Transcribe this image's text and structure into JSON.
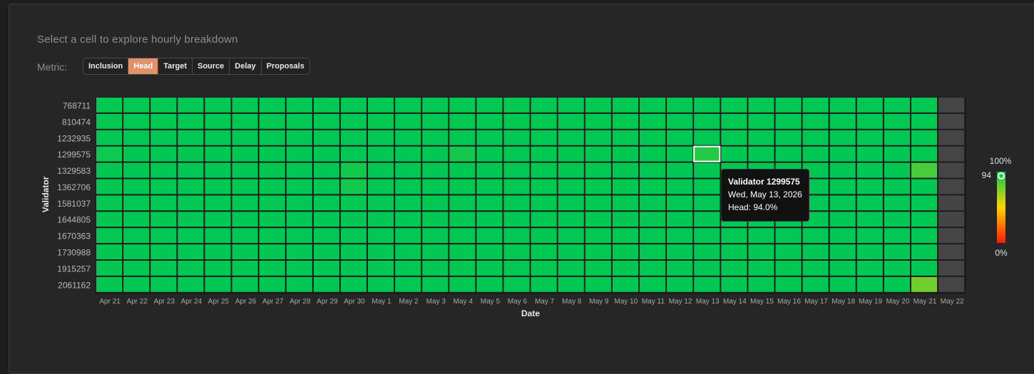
{
  "subtitle": "Select a cell to explore hourly breakdown",
  "metric": {
    "label": "Metric:",
    "options": [
      "Inclusion",
      "Head",
      "Target",
      "Source",
      "Delay",
      "Proposals"
    ],
    "selected": "Head"
  },
  "chart_data": {
    "type": "heatmap",
    "xlabel": "Date",
    "ylabel": "Validator",
    "x": [
      "Apr 21",
      "Apr 22",
      "Apr 23",
      "Apr 24",
      "Apr 25",
      "Apr 26",
      "Apr 27",
      "Apr 28",
      "Apr 29",
      "Apr 30",
      "May 1",
      "May 2",
      "May 3",
      "May 4",
      "May 5",
      "May 6",
      "May 7",
      "May 8",
      "May 9",
      "May 10",
      "May 11",
      "May 12",
      "May 13",
      "May 14",
      "May 15",
      "May 16",
      "May 17",
      "May 18",
      "May 19",
      "May 20",
      "May 21",
      "May 22"
    ],
    "y": [
      "768711",
      "810474",
      "1232935",
      "1299575",
      "1329583",
      "1362706",
      "1581037",
      "1644805",
      "1670363",
      "1730988",
      "1915257",
      "2061162"
    ],
    "values": [
      [
        100,
        100,
        100,
        100,
        100,
        100,
        100,
        100,
        100,
        100,
        100,
        100,
        100,
        100,
        100,
        99,
        100,
        100,
        100,
        100,
        100,
        100,
        100,
        100,
        100,
        100,
        100,
        100,
        100,
        100,
        100,
        null
      ],
      [
        100,
        100,
        100,
        100,
        100,
        100,
        100,
        100,
        100,
        100,
        99,
        100,
        100,
        100,
        100,
        100,
        100,
        100,
        100,
        100,
        100,
        100,
        100,
        100,
        100,
        100,
        100,
        100,
        100,
        100,
        100,
        null
      ],
      [
        100,
        100,
        100,
        100,
        100,
        100,
        100,
        100,
        100,
        100,
        100,
        100,
        100,
        100,
        100,
        100,
        100,
        100,
        100,
        100,
        100,
        100,
        100,
        100,
        100,
        100,
        100,
        100,
        100,
        100,
        100,
        null
      ],
      [
        97,
        100,
        100,
        99,
        100,
        100,
        100,
        100,
        100,
        100,
        100,
        100,
        100,
        96,
        100,
        100,
        100,
        99,
        100,
        100,
        100,
        100,
        94,
        100,
        100,
        100,
        100,
        100,
        100,
        100,
        100,
        null
      ],
      [
        100,
        100,
        100,
        100,
        100,
        100,
        99,
        100,
        100,
        96,
        100,
        100,
        100,
        100,
        100,
        100,
        100,
        100,
        100,
        100,
        100,
        100,
        100,
        100,
        100,
        100,
        100,
        100,
        100,
        100,
        91,
        null
      ],
      [
        100,
        100,
        100,
        100,
        100,
        100,
        100,
        100,
        100,
        96,
        100,
        100,
        100,
        100,
        100,
        100,
        100,
        100,
        100,
        100,
        100,
        100,
        100,
        100,
        100,
        100,
        100,
        100,
        100,
        100,
        100,
        null
      ],
      [
        100,
        100,
        100,
        100,
        100,
        100,
        100,
        100,
        100,
        100,
        100,
        100,
        99,
        100,
        100,
        100,
        100,
        100,
        100,
        100,
        100,
        100,
        100,
        100,
        100,
        100,
        100,
        100,
        100,
        100,
        100,
        null
      ],
      [
        100,
        100,
        100,
        100,
        100,
        100,
        100,
        100,
        100,
        100,
        100,
        100,
        100,
        100,
        100,
        100,
        100,
        100,
        100,
        100,
        100,
        100,
        100,
        100,
        100,
        100,
        100,
        100,
        100,
        100,
        100,
        null
      ],
      [
        100,
        100,
        100,
        100,
        100,
        100,
        100,
        100,
        100,
        100,
        100,
        100,
        100,
        100,
        100,
        100,
        99,
        100,
        100,
        100,
        100,
        100,
        100,
        100,
        100,
        100,
        100,
        100,
        100,
        100,
        100,
        null
      ],
      [
        100,
        100,
        100,
        100,
        100,
        100,
        100,
        100,
        100,
        100,
        100,
        100,
        100,
        100,
        100,
        100,
        100,
        100,
        100,
        100,
        100,
        100,
        100,
        100,
        100,
        100,
        100,
        100,
        100,
        100,
        100,
        null
      ],
      [
        100,
        100,
        100,
        100,
        100,
        100,
        100,
        100,
        100,
        100,
        100,
        100,
        100,
        100,
        100,
        100,
        100,
        100,
        100,
        100,
        100,
        100,
        100,
        100,
        100,
        99,
        100,
        100,
        100,
        100,
        100,
        null
      ],
      [
        100,
        100,
        100,
        100,
        100,
        100,
        100,
        100,
        100,
        100,
        100,
        100,
        100,
        100,
        100,
        100,
        100,
        100,
        100,
        100,
        100,
        100,
        100,
        100,
        100,
        100,
        100,
        100,
        100,
        100,
        88,
        null
      ]
    ],
    "selected_cell": {
      "row": 3,
      "col": 22
    },
    "legend": {
      "max_label": "100%",
      "min_label": "0%",
      "marker_label": "94",
      "marker_value": 94
    },
    "colors": {
      "high": "#00c853",
      "mid": "#ffd600",
      "low": "#ff1a00",
      "empty": "#454545",
      "selected_border": "#ffffff"
    }
  },
  "tooltip": {
    "title": "Validator 1299575",
    "date": "Wed, May 13, 2026",
    "value": "Head: 94.0%"
  }
}
